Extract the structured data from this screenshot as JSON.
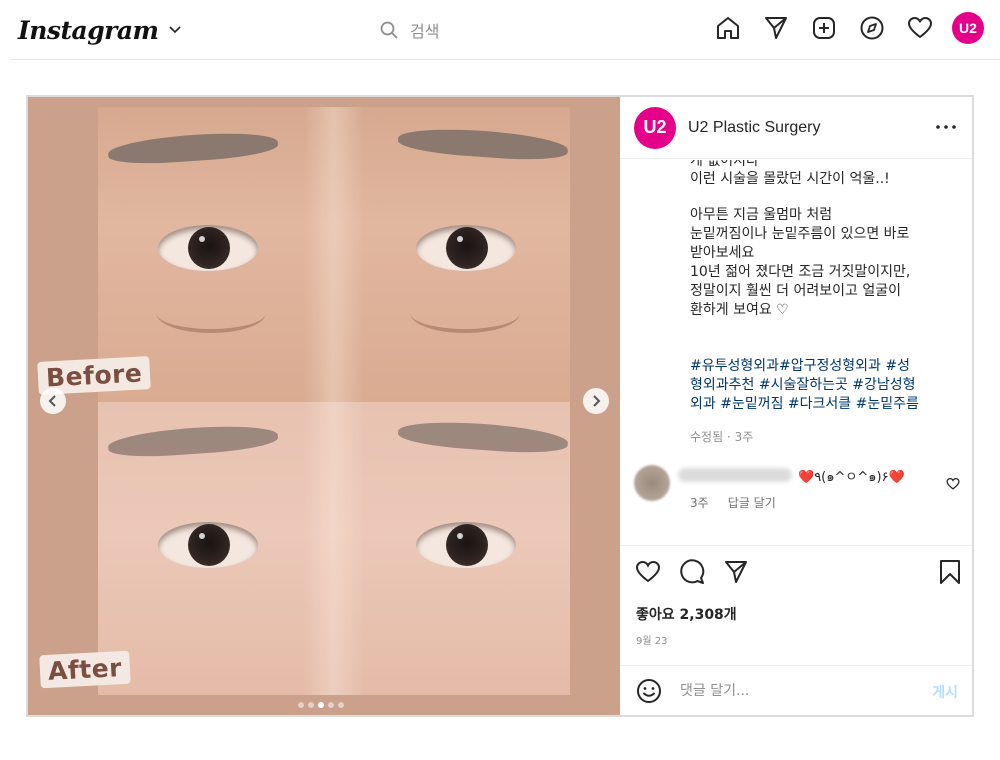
{
  "app": {
    "logo_text": "Instagram",
    "search_placeholder": "검색",
    "nav": {
      "home_icon": "home-icon",
      "direct_icon": "paper-plane-icon",
      "create_icon": "plus-square-icon",
      "explore_icon": "compass-icon",
      "activity_icon": "heart-icon",
      "avatar_text": "U2"
    },
    "brand_color": "#e5008a"
  },
  "post": {
    "account": {
      "name": "U2 Plastic Surgery",
      "avatar_text": "U2"
    },
    "media": {
      "before_label": "Before",
      "after_label": "After",
      "carousel_count": 5,
      "carousel_active_index": 2
    },
    "caption": {
      "partial_top_line": "게 없어지다",
      "lines": [
        "이런 시술을 몰랐던 시간이 억울..!",
        "",
        "아무튼 지금 울멈마 처럼",
        "눈밑꺼짐이나 눈밑주름이 있으면 바로",
        "받아보세요",
        "10년 젊어 졌다면 조금 거짓말이지만,",
        "정말이지 훨씬 더 어려보이고 얼굴이",
        "환하게 보여요 ♡"
      ],
      "hashtags": [
        "#유투성형외과#압구정성형외과 #성",
        "형외과추천 #시술잘하는곳 #강남성형",
        "외과 #눈밑꺼짐 #다크서클 #눈밑주름"
      ],
      "meta": "수정됨 · 3주"
    },
    "comment": {
      "text": "❤️٩(๑^ㅇ^๑)۶❤️",
      "time": "3주",
      "reply_label": "답글 달기"
    },
    "likes_text": "좋아요 2,308개",
    "date_text": "9월 23",
    "comment_placeholder": "댓글 달기...",
    "post_button": "게시"
  }
}
